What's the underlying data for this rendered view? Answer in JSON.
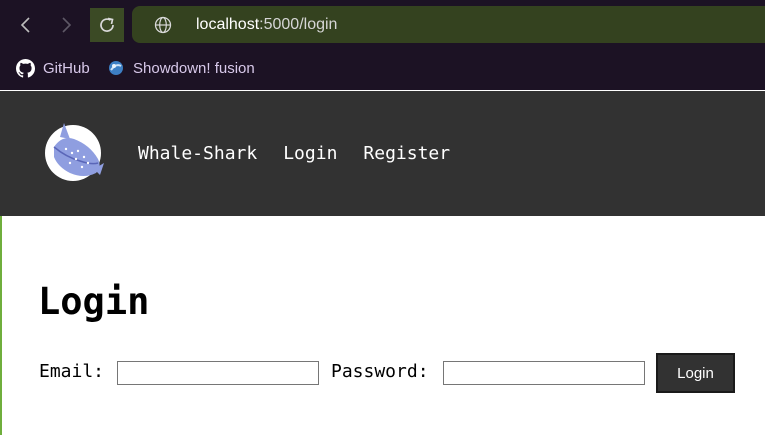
{
  "browser": {
    "url_host": "localhost",
    "url_path": ":5000/login",
    "bookmarks": [
      {
        "label": "GitHub",
        "icon": "github-icon"
      },
      {
        "label": "Showdown! fusion",
        "icon": "showdown-icon"
      }
    ]
  },
  "header": {
    "logo": "whale-shark-logo",
    "nav": {
      "home": "Whale-Shark",
      "login": "Login",
      "register": "Register"
    },
    "background": "#323232"
  },
  "main": {
    "title": "Login",
    "form": {
      "email_label": "Email:",
      "email_value": "",
      "password_label": "Password:",
      "password_value": "",
      "submit_label": "Login"
    }
  },
  "colors": {
    "chrome_bg": "#1c1224",
    "address_bar_bg": "#34421f",
    "button_bg": "#323232"
  }
}
